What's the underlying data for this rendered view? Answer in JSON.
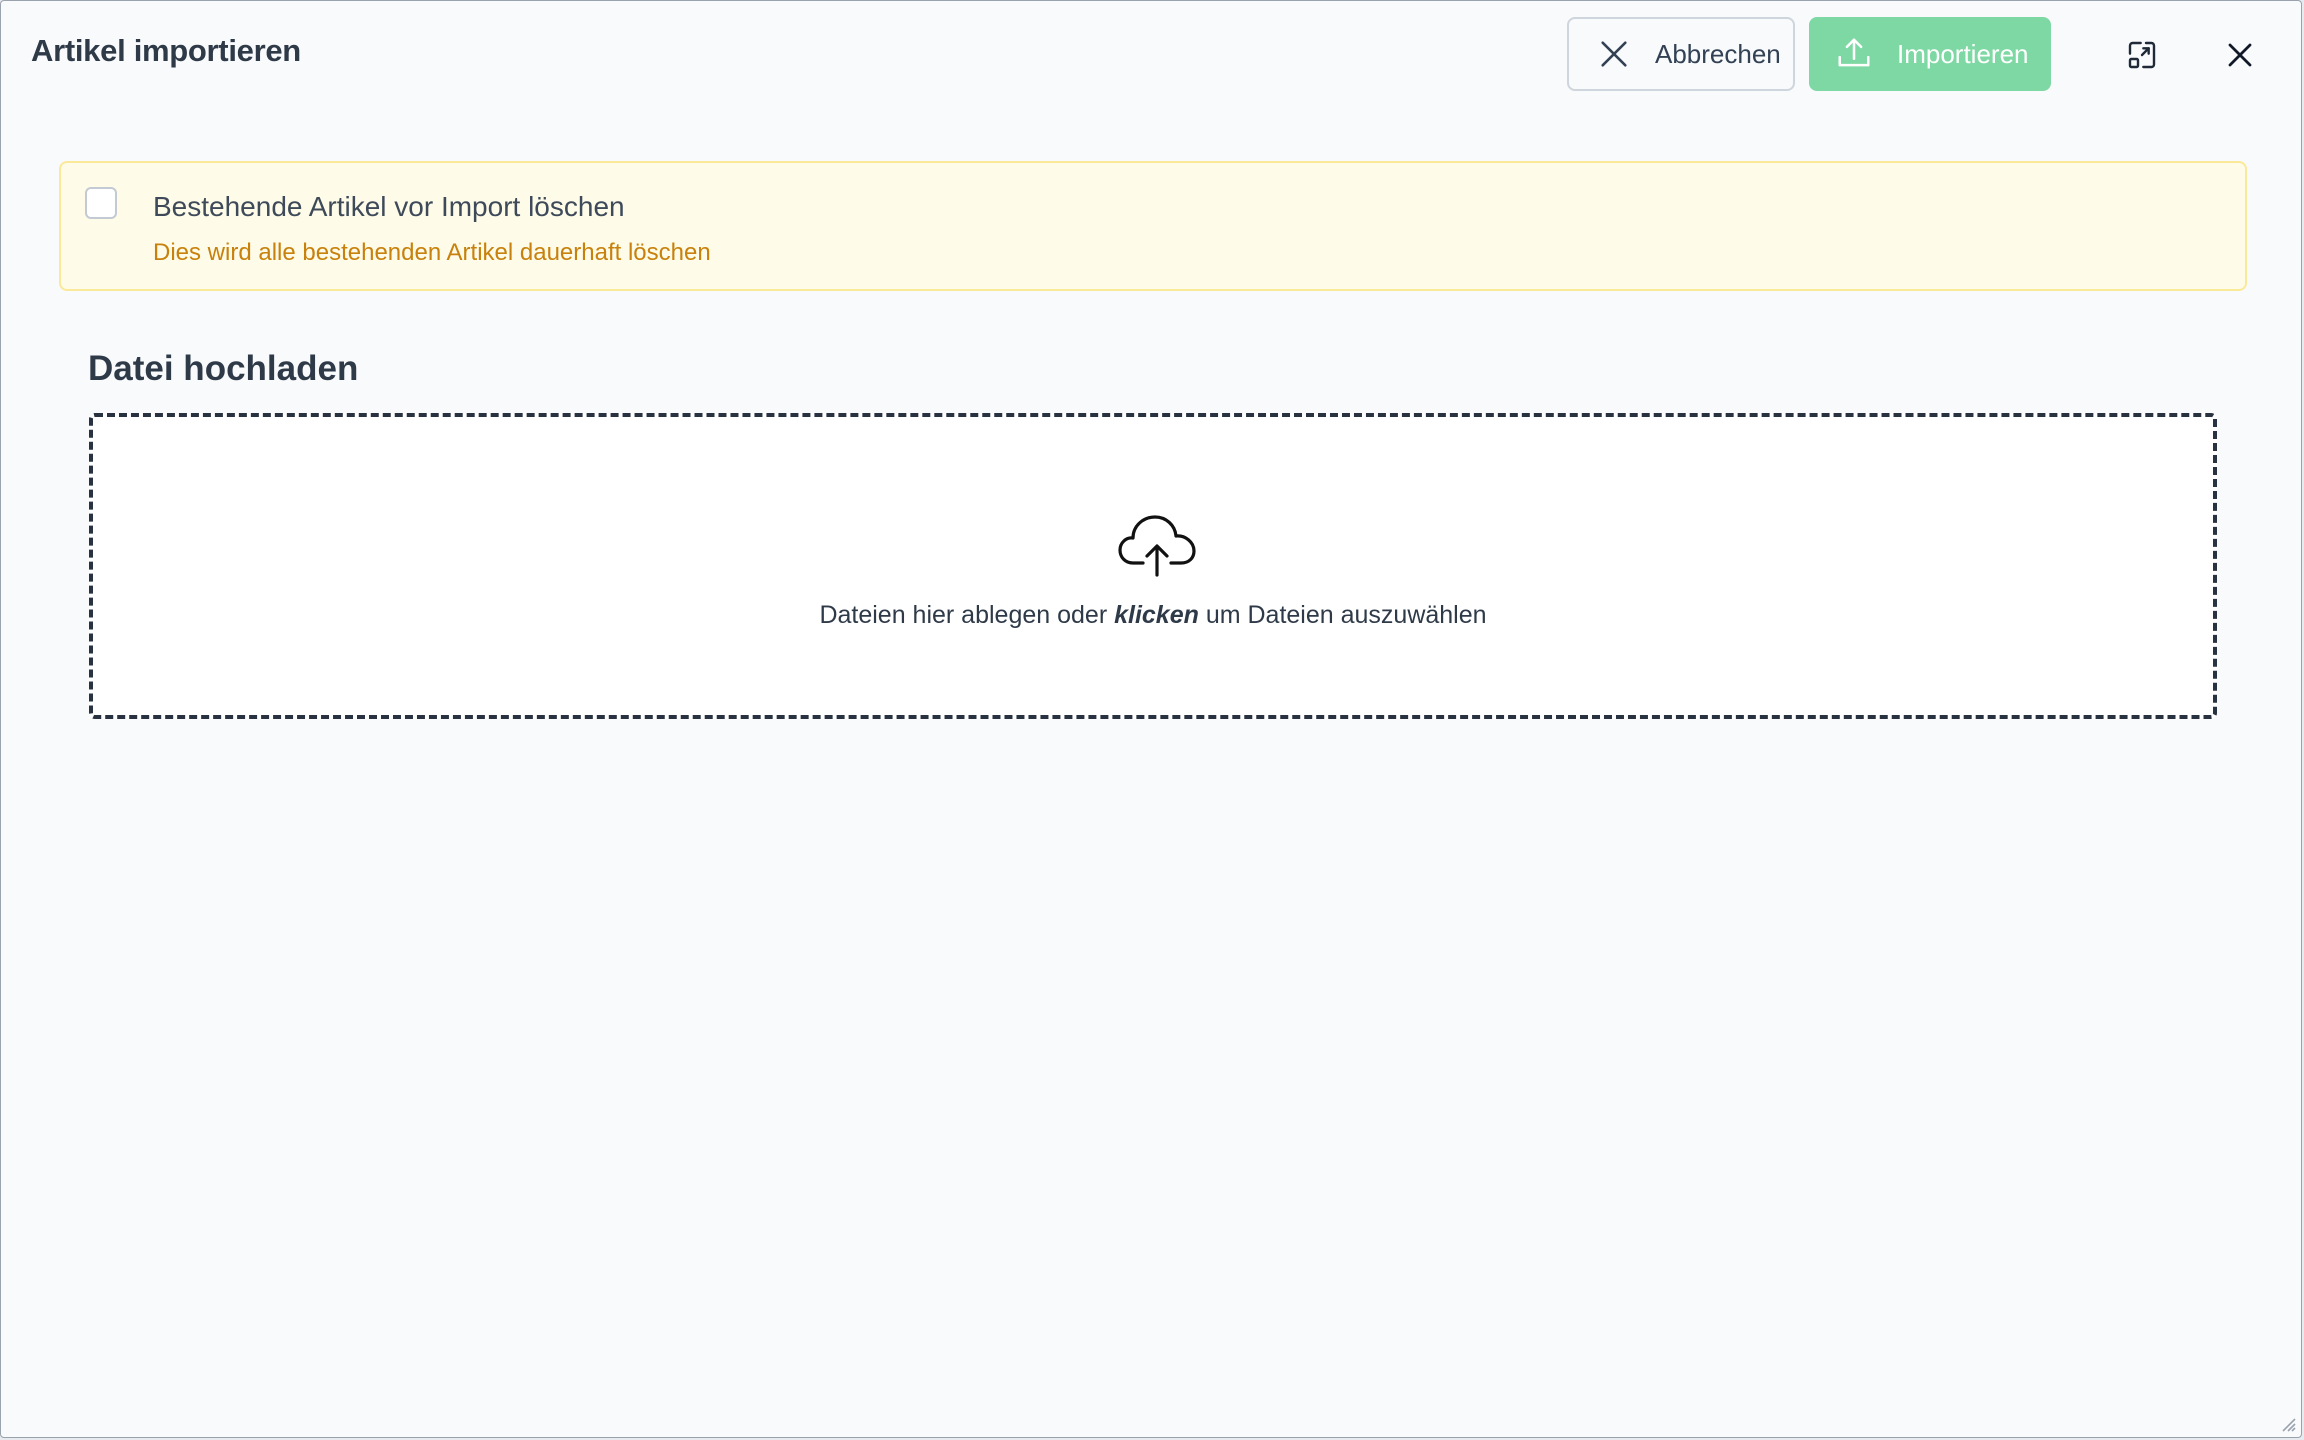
{
  "dialog": {
    "title": "Artikel importieren",
    "cancel_label": "Abbrechen",
    "import_label": "Importieren",
    "icons": {
      "cancel": "x-icon",
      "import": "upload-icon",
      "maximize": "maximize-icon",
      "close": "close-icon"
    }
  },
  "delete_option": {
    "checked": false,
    "label": "Bestehende Artikel vor Import löschen",
    "help": "Dies wird alle bestehenden Artikel dauerhaft löschen"
  },
  "upload": {
    "section_title": "Datei hochladen",
    "icon": "cloud-upload-icon",
    "text_before": "Dateien hier ablegen oder ",
    "text_emphasis": "klicken",
    "text_after": " um Dateien auszuwählen"
  },
  "colors": {
    "import_button": "#7dd8a3",
    "warning_bg": "#fefbe8",
    "warning_text": "#c8810c"
  }
}
